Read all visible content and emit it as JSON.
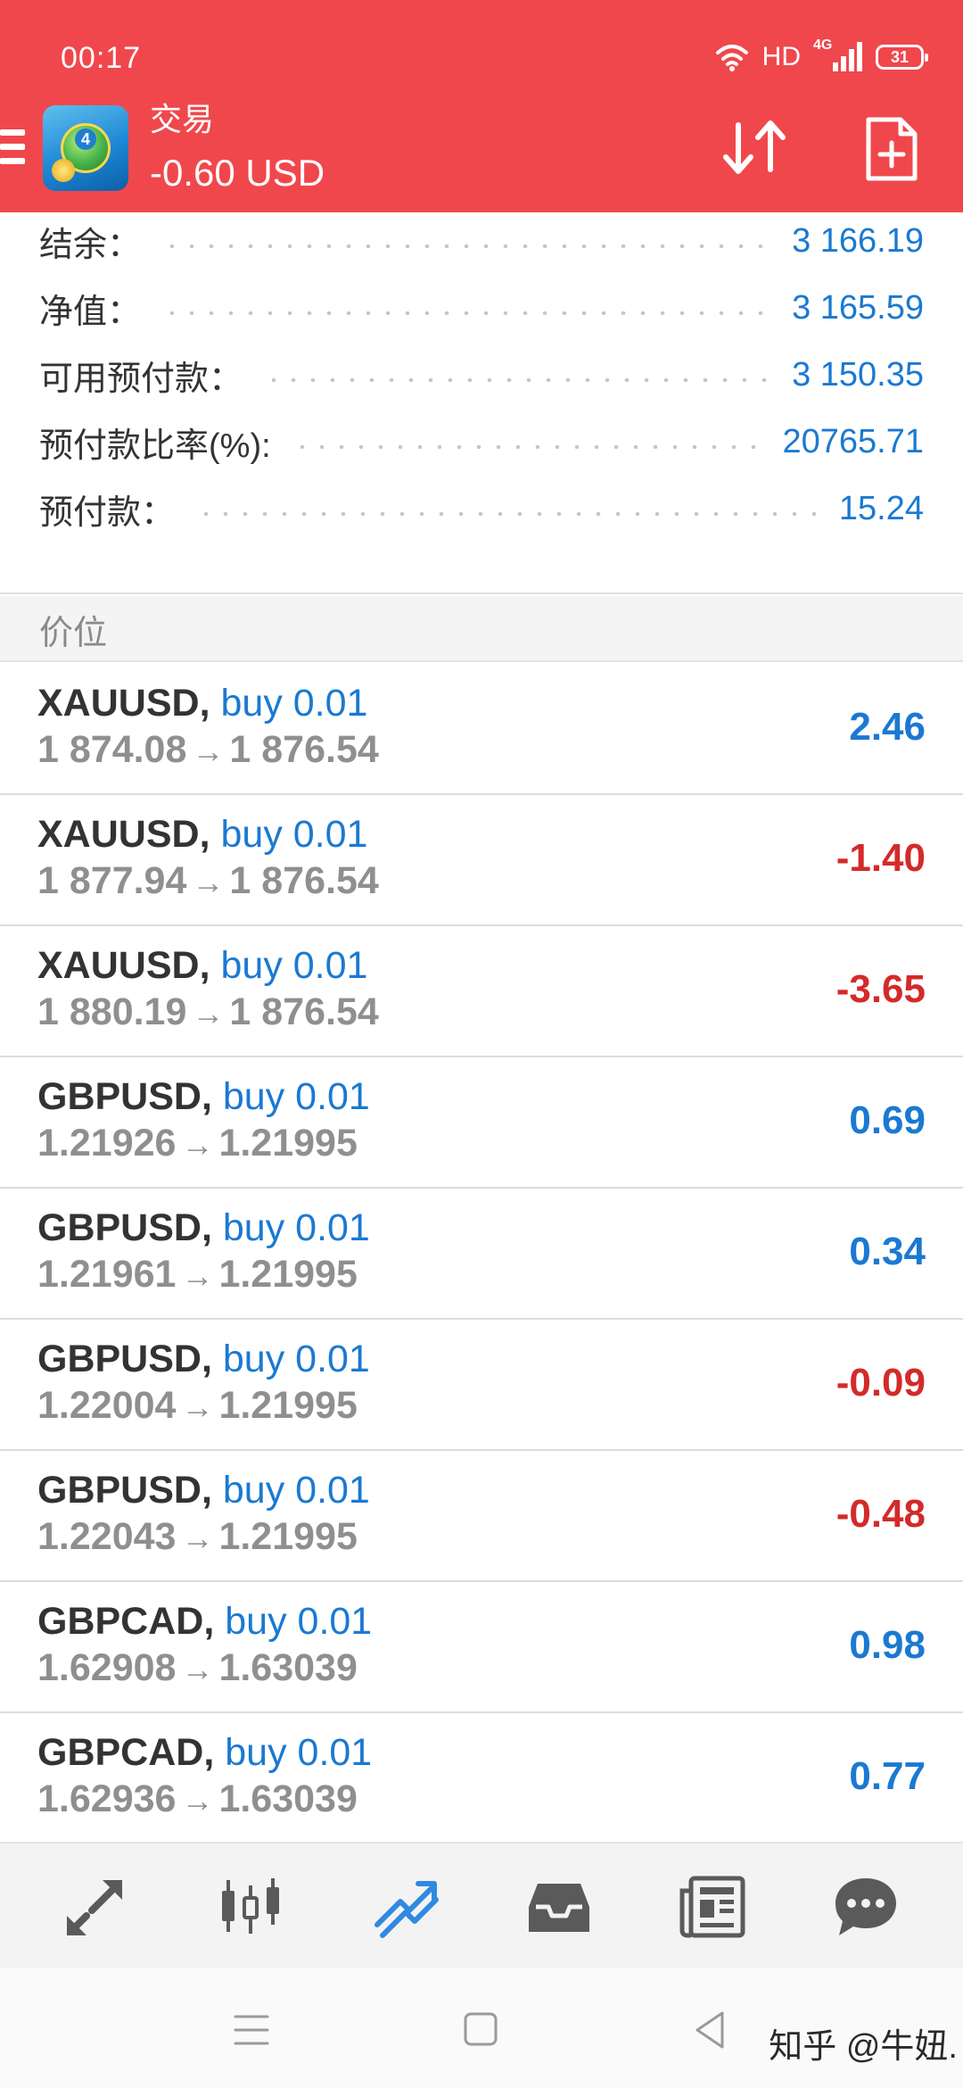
{
  "status_bar": {
    "time": "00:17",
    "network": "HD",
    "cell": "4G",
    "battery": "31"
  },
  "header": {
    "title": "交易",
    "balance_delta": "-0.60 USD",
    "brand_color": "#f0474c",
    "icons": [
      "menu-icon",
      "app-logo-icon",
      "sort-icon",
      "new-order-icon"
    ]
  },
  "summary": [
    {
      "label": "结余：",
      "value": "3 166.19"
    },
    {
      "label": "净值：",
      "value": "3 165.59"
    },
    {
      "label": "可用预付款：",
      "value": "3 150.35"
    },
    {
      "label": "预付款比率(%):",
      "value": "20765.71"
    },
    {
      "label": "预付款：",
      "value": "15.24"
    }
  ],
  "section_title": "价位",
  "positions": [
    {
      "symbol": "XAUUSD,",
      "side": "buy 0.01",
      "open": "1 874.08",
      "arrow": "→",
      "current": "1 876.54",
      "profit": "2.46",
      "sign": "pos"
    },
    {
      "symbol": "XAUUSD,",
      "side": "buy 0.01",
      "open": "1 877.94",
      "arrow": "→",
      "current": "1 876.54",
      "profit": "-1.40",
      "sign": "neg"
    },
    {
      "symbol": "XAUUSD,",
      "side": "buy 0.01",
      "open": "1 880.19",
      "arrow": "→",
      "current": "1 876.54",
      "profit": "-3.65",
      "sign": "neg"
    },
    {
      "symbol": "GBPUSD,",
      "side": "buy 0.01",
      "open": "1.21926",
      "arrow": "→",
      "current": "1.21995",
      "profit": "0.69",
      "sign": "pos"
    },
    {
      "symbol": "GBPUSD,",
      "side": "buy 0.01",
      "open": "1.21961",
      "arrow": "→",
      "current": "1.21995",
      "profit": "0.34",
      "sign": "pos"
    },
    {
      "symbol": "GBPUSD,",
      "side": "buy 0.01",
      "open": "1.22004",
      "arrow": "→",
      "current": "1.21995",
      "profit": "-0.09",
      "sign": "neg"
    },
    {
      "symbol": "GBPUSD,",
      "side": "buy 0.01",
      "open": "1.22043",
      "arrow": "→",
      "current": "1.21995",
      "profit": "-0.48",
      "sign": "neg"
    },
    {
      "symbol": "GBPCAD,",
      "side": "buy 0.01",
      "open": "1.62908",
      "arrow": "→",
      "current": "1.63039",
      "profit": "0.98",
      "sign": "pos"
    },
    {
      "symbol": "GBPCAD,",
      "side": "buy 0.01",
      "open": "1.62936",
      "arrow": "→",
      "current": "1.63039",
      "profit": "0.77",
      "sign": "pos"
    }
  ],
  "colors": {
    "profit_positive": "#1b79d1",
    "profit_negative": "#d32a2a",
    "active_tab": "#2f8ae0",
    "inactive_tab": "#5a5a5a"
  },
  "tabbar": {
    "items": [
      "quotes-icon",
      "chart-icon",
      "trade-icon",
      "history-icon",
      "news-icon",
      "chat-icon"
    ],
    "active": "trade-icon"
  },
  "system_nav": {
    "items": [
      "recents-icon",
      "home-icon",
      "back-icon"
    ],
    "watermark": "知乎 @牛妞."
  }
}
